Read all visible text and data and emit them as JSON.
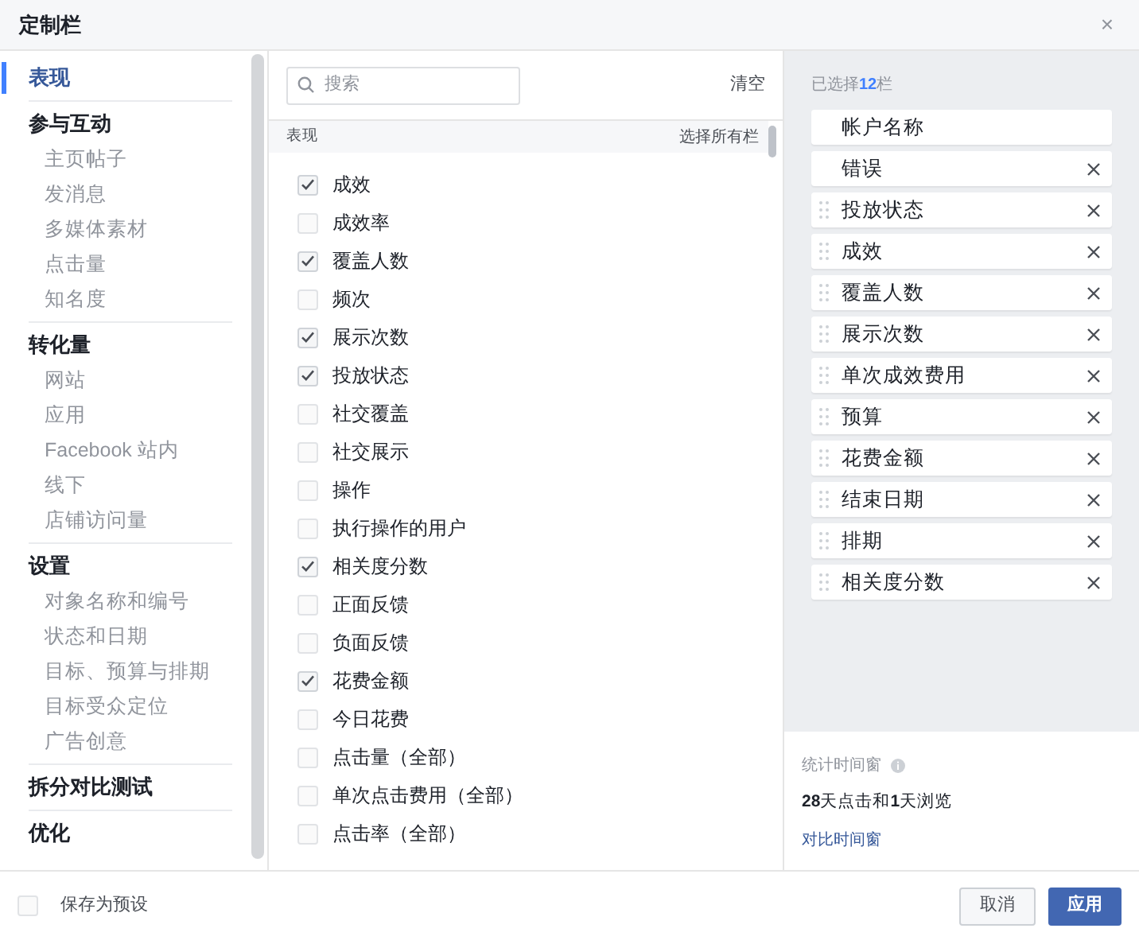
{
  "window": {
    "title": "定制栏",
    "close": "×"
  },
  "sidebar": {
    "sections": [
      {
        "title": "表现",
        "selected": true
      },
      {
        "title": "参与互动",
        "selected": false,
        "items": [
          "主页帖子",
          "发消息",
          "多媒体素材",
          "点击量",
          "知名度"
        ]
      },
      {
        "title": "转化量",
        "selected": false,
        "items": [
          "网站",
          "应用",
          "Facebook 站内",
          "线下",
          "店铺访问量"
        ]
      },
      {
        "title": "设置",
        "selected": false,
        "items": [
          "对象名称和编号",
          "状态和日期",
          "目标、预算与排期",
          "目标受众定位",
          "广告创意"
        ]
      },
      {
        "title": "拆分对比测试",
        "selected": false
      },
      {
        "title": "优化",
        "selected": false
      }
    ]
  },
  "search": {
    "placeholder": "搜索"
  },
  "clear": "清空",
  "list_header": {
    "title": "表现",
    "select_all": "选择所有栏"
  },
  "columns": [
    {
      "label": "成效",
      "checked": true
    },
    {
      "label": "成效率",
      "checked": false
    },
    {
      "label": "覆盖人数",
      "checked": true
    },
    {
      "label": "频次",
      "checked": false
    },
    {
      "label": "展示次数",
      "checked": true
    },
    {
      "label": "投放状态",
      "checked": true
    },
    {
      "label": "社交覆盖",
      "checked": false
    },
    {
      "label": "社交展示",
      "checked": false
    },
    {
      "label": "操作",
      "checked": false
    },
    {
      "label": "执行操作的用户",
      "checked": false
    },
    {
      "label": "相关度分数",
      "checked": true
    },
    {
      "label": "正面反馈",
      "checked": false
    },
    {
      "label": "负面反馈",
      "checked": false
    },
    {
      "label": "花费金额",
      "checked": true
    },
    {
      "label": "今日花费",
      "checked": false
    },
    {
      "label": "点击量（全部）",
      "checked": false
    },
    {
      "label": "单次点击费用（全部）",
      "checked": false
    },
    {
      "label": "点击率（全部）",
      "checked": false
    }
  ],
  "selected_panel": {
    "title": "已选择**12**栏",
    "items": [
      {
        "label": "帐户名称",
        "draggable": false,
        "removable": false
      },
      {
        "label": "错误",
        "draggable": false,
        "removable": true
      },
      {
        "label": "投放状态",
        "draggable": true,
        "removable": true
      },
      {
        "label": "成效",
        "draggable": true,
        "removable": true
      },
      {
        "label": "覆盖人数",
        "draggable": true,
        "removable": true
      },
      {
        "label": "展示次数",
        "draggable": true,
        "removable": true
      },
      {
        "label": "单次成效费用",
        "draggable": true,
        "removable": true
      },
      {
        "label": "预算",
        "draggable": true,
        "removable": true
      },
      {
        "label": "花费金额",
        "draggable": true,
        "removable": true
      },
      {
        "label": "结束日期",
        "draggable": true,
        "removable": true
      },
      {
        "label": "排期",
        "draggable": true,
        "removable": true
      },
      {
        "label": "相关度分数",
        "draggable": true,
        "removable": true
      }
    ]
  },
  "attribution": {
    "label": "统计时间窗",
    "value": "**28**天点击和**1**天浏览",
    "link": "对比时间窗"
  },
  "footer": {
    "save_preset": {
      "label": "保存为预设",
      "checked": false
    },
    "cancel": "取消",
    "apply": "应用"
  }
}
